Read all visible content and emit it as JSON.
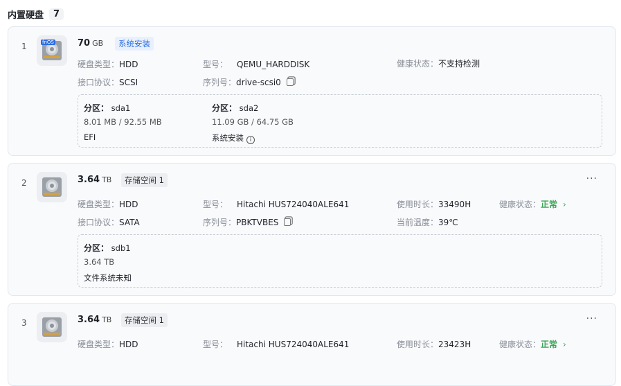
{
  "header": {
    "title": "内置硬盘",
    "count": "7"
  },
  "disks": [
    {
      "index": "1",
      "logo": "fnOS",
      "size": "70",
      "unit": "GB",
      "tag": "系统安装",
      "type_label": "硬盘类型：",
      "type": "HDD",
      "model_label": "型号：",
      "model": "QEMU_HARDDISK",
      "health_label": "健康状态：",
      "health": "不支持检测",
      "iface_label": "接口协议：",
      "iface": "SCSI",
      "serial_label": "序列号：",
      "serial": "drive-scsi0",
      "partitions": [
        {
          "label": "分区：",
          "name": "sda1",
          "usage": "8.01 MB / 92.55 MB",
          "fs": "EFI"
        },
        {
          "label": "分区：",
          "name": "sda2",
          "usage": "11.09 GB / 64.75 GB",
          "fs": "系统安装"
        }
      ]
    },
    {
      "index": "2",
      "size": "3.64",
      "unit": "TB",
      "tag": "存储空间 1",
      "type_label": "硬盘类型：",
      "type": "HDD",
      "model_label": "型号：",
      "model": "Hitachi HUS724040ALE641",
      "hours_label": "使用时长：",
      "hours": "33490H",
      "health_label": "健康状态：",
      "health": "正常",
      "iface_label": "接口协议：",
      "iface": "SATA",
      "serial_label": "序列号：",
      "serial": "PBKTVBES",
      "temp_label": "当前温度：",
      "temp": "39℃",
      "partitions": [
        {
          "label": "分区：",
          "name": "sdb1",
          "usage": "3.64 TB",
          "fs": "文件系统未知"
        }
      ]
    },
    {
      "index": "3",
      "size": "3.64",
      "unit": "TB",
      "tag": "存储空间 1",
      "type_label": "硬盘类型：",
      "type": "HDD",
      "model_label": "型号：",
      "model": "Hitachi HUS724040ALE641",
      "hours_label": "使用时长：",
      "hours": "23423H",
      "health_label": "健康状态：",
      "health": "正常"
    }
  ]
}
